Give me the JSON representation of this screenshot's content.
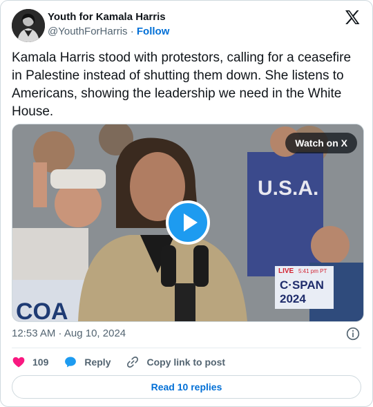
{
  "author": {
    "name": "Youth for Kamala Harris",
    "handle": "@YouthForHarris",
    "separator": "·",
    "follow_label": "Follow",
    "avatar_icon": "profile-avatar"
  },
  "tweet": {
    "text": "Kamala Harris stood with protestors, calling for a ceasefire in Palestine instead of shutting them down. She listens to Americans, showing the leadership we need in the White House."
  },
  "media": {
    "watch_label": "Watch on X",
    "play_icon": "play-icon",
    "overlay": {
      "live_label": "LIVE",
      "live_time": "5:41 pm PT",
      "network": "C·SPAN",
      "year": "2024",
      "shirt_text": "U.S.A.",
      "banner_text": "COA"
    }
  },
  "meta": {
    "timestamp": "12:53 AM · Aug 10, 2024",
    "info_icon": "info-icon"
  },
  "actions": {
    "like_count": "109",
    "reply_label": "Reply",
    "copy_label": "Copy link to post"
  },
  "footer": {
    "read_replies_label": "Read 10 replies"
  },
  "colors": {
    "link": "#006fd6",
    "like": "#f91880",
    "reply": "#1d9bf0",
    "muted": "#536471",
    "text": "#0f1419",
    "border": "#cfd9de"
  }
}
